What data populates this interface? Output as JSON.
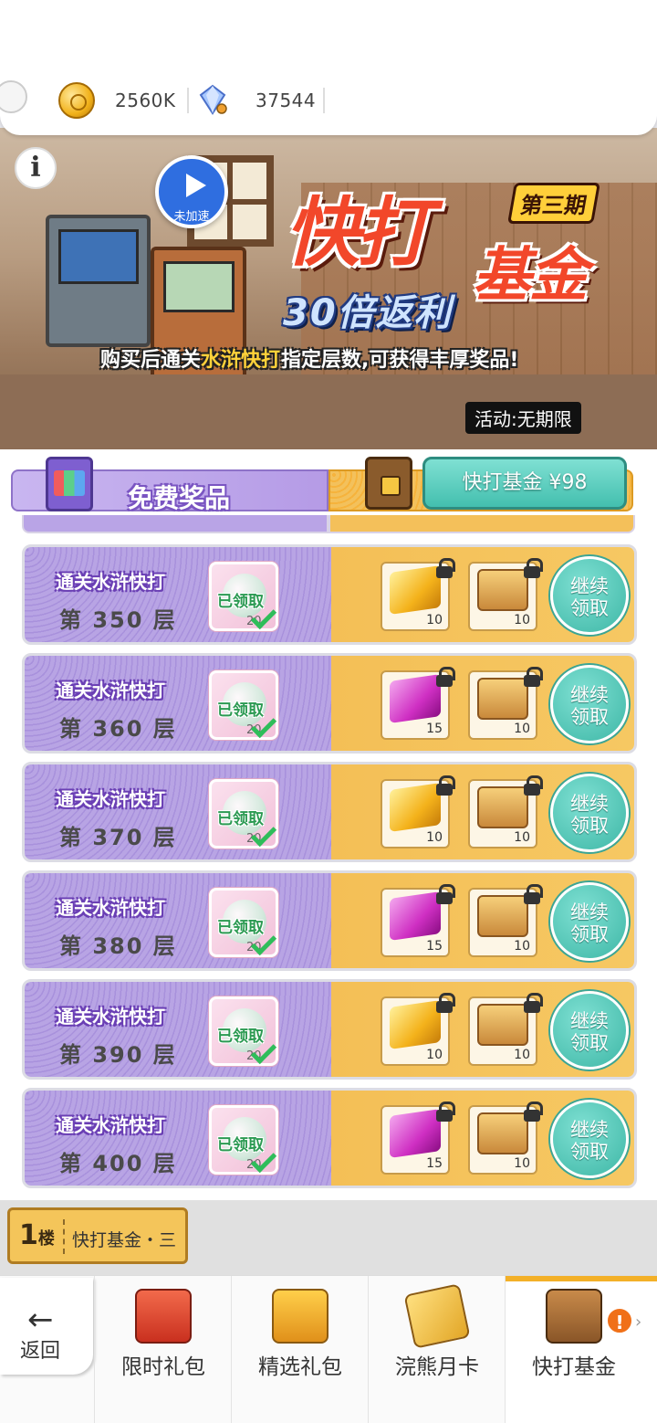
{
  "topbar": {
    "coins": "2560K",
    "gems": "37544"
  },
  "banner": {
    "title": "快打",
    "subtitle": "基金",
    "period": "第三期",
    "rebate": "30倍返利",
    "desc_pre": "购买后通关",
    "desc_hl": "水浒快打",
    "desc_post": "指定层数,可获得丰厚奖品!",
    "activity": "活动:无期限",
    "play_label": "未加速"
  },
  "header": {
    "free_label": "免费奖品",
    "buy_label": "快打基金 ¥98"
  },
  "rows": [
    {
      "title": "通关水浒快打",
      "floor": "第 350 层",
      "claimed": "已领取",
      "free_qty": "20",
      "paid": [
        {
          "kind": "gold",
          "qty": "10"
        },
        {
          "kind": "box",
          "qty": "10"
        }
      ],
      "button": "继续\n领取"
    },
    {
      "title": "通关水浒快打",
      "floor": "第 360 层",
      "claimed": "已领取",
      "free_qty": "20",
      "paid": [
        {
          "kind": "pink",
          "qty": "15"
        },
        {
          "kind": "box",
          "qty": "10"
        }
      ],
      "button": "继续\n领取"
    },
    {
      "title": "通关水浒快打",
      "floor": "第 370 层",
      "claimed": "已领取",
      "free_qty": "20",
      "paid": [
        {
          "kind": "gold",
          "qty": "10"
        },
        {
          "kind": "box",
          "qty": "10"
        }
      ],
      "button": "继续\n领取"
    },
    {
      "title": "通关水浒快打",
      "floor": "第 380 层",
      "claimed": "已领取",
      "free_qty": "20",
      "paid": [
        {
          "kind": "pink",
          "qty": "15"
        },
        {
          "kind": "box",
          "qty": "10"
        }
      ],
      "button": "继续\n领取"
    },
    {
      "title": "通关水浒快打",
      "floor": "第 390 层",
      "claimed": "已领取",
      "free_qty": "20",
      "paid": [
        {
          "kind": "gold",
          "qty": "10"
        },
        {
          "kind": "box",
          "qty": "10"
        }
      ],
      "button": "继续\n领取"
    },
    {
      "title": "通关水浒快打",
      "floor": "第 400 层",
      "claimed": "已领取",
      "free_qty": "20",
      "paid": [
        {
          "kind": "pink",
          "qty": "15"
        },
        {
          "kind": "box",
          "qty": "10"
        }
      ],
      "button": "继续\n领取"
    }
  ],
  "floorbar": {
    "num": "1",
    "unit": "楼",
    "name": "快打基金・三"
  },
  "nav": {
    "back": "返回",
    "items": [
      {
        "label": "限时礼包",
        "icon": "shopping-bag-icon"
      },
      {
        "label": "精选礼包",
        "icon": "gift-box-icon"
      },
      {
        "label": "浣熊月卡",
        "icon": "month-card-icon"
      },
      {
        "label": "快打基金",
        "icon": "fund-chest-icon"
      }
    ],
    "active_index": 3
  }
}
